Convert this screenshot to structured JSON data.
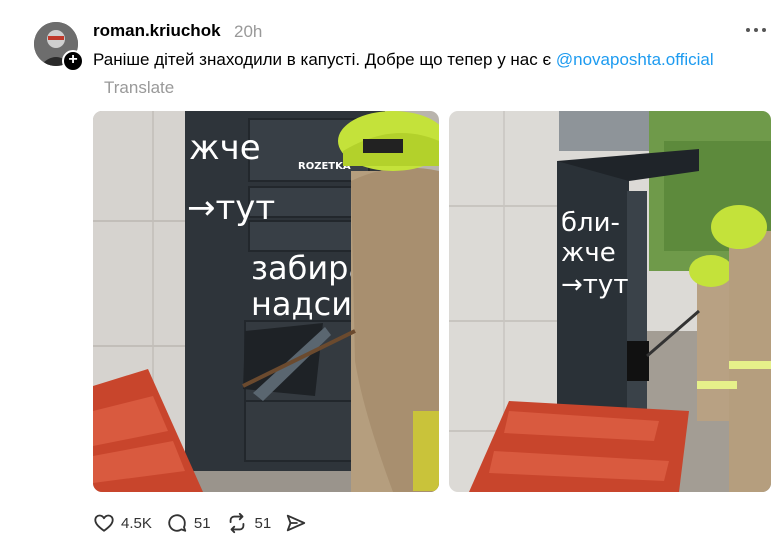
{
  "post": {
    "username": "roman.kriuchok",
    "timestamp": "20h",
    "caption_text": "Раніше дітей знаходили в капусті. Добре що тепер у нас є ",
    "mention": "@novaposhta.official",
    "translate_label": "Translate",
    "follow_symbol": "+",
    "media": {
      "left_sign": {
        "line1": "жче",
        "line2": "→тут",
        "brand": "ROZETKA",
        "door1": "забира",
        "door2": "надсил"
      },
      "right_sign": {
        "line1": "бли-",
        "line2": "жче",
        "line3": "→тут"
      }
    }
  },
  "actions": {
    "like_count": "4.5K",
    "comment_count": "51",
    "repost_count": "51"
  },
  "icons": [
    "avatar",
    "follow-plus-icon",
    "more-icon",
    "heart-icon",
    "comment-icon",
    "repost-icon",
    "share-icon"
  ]
}
